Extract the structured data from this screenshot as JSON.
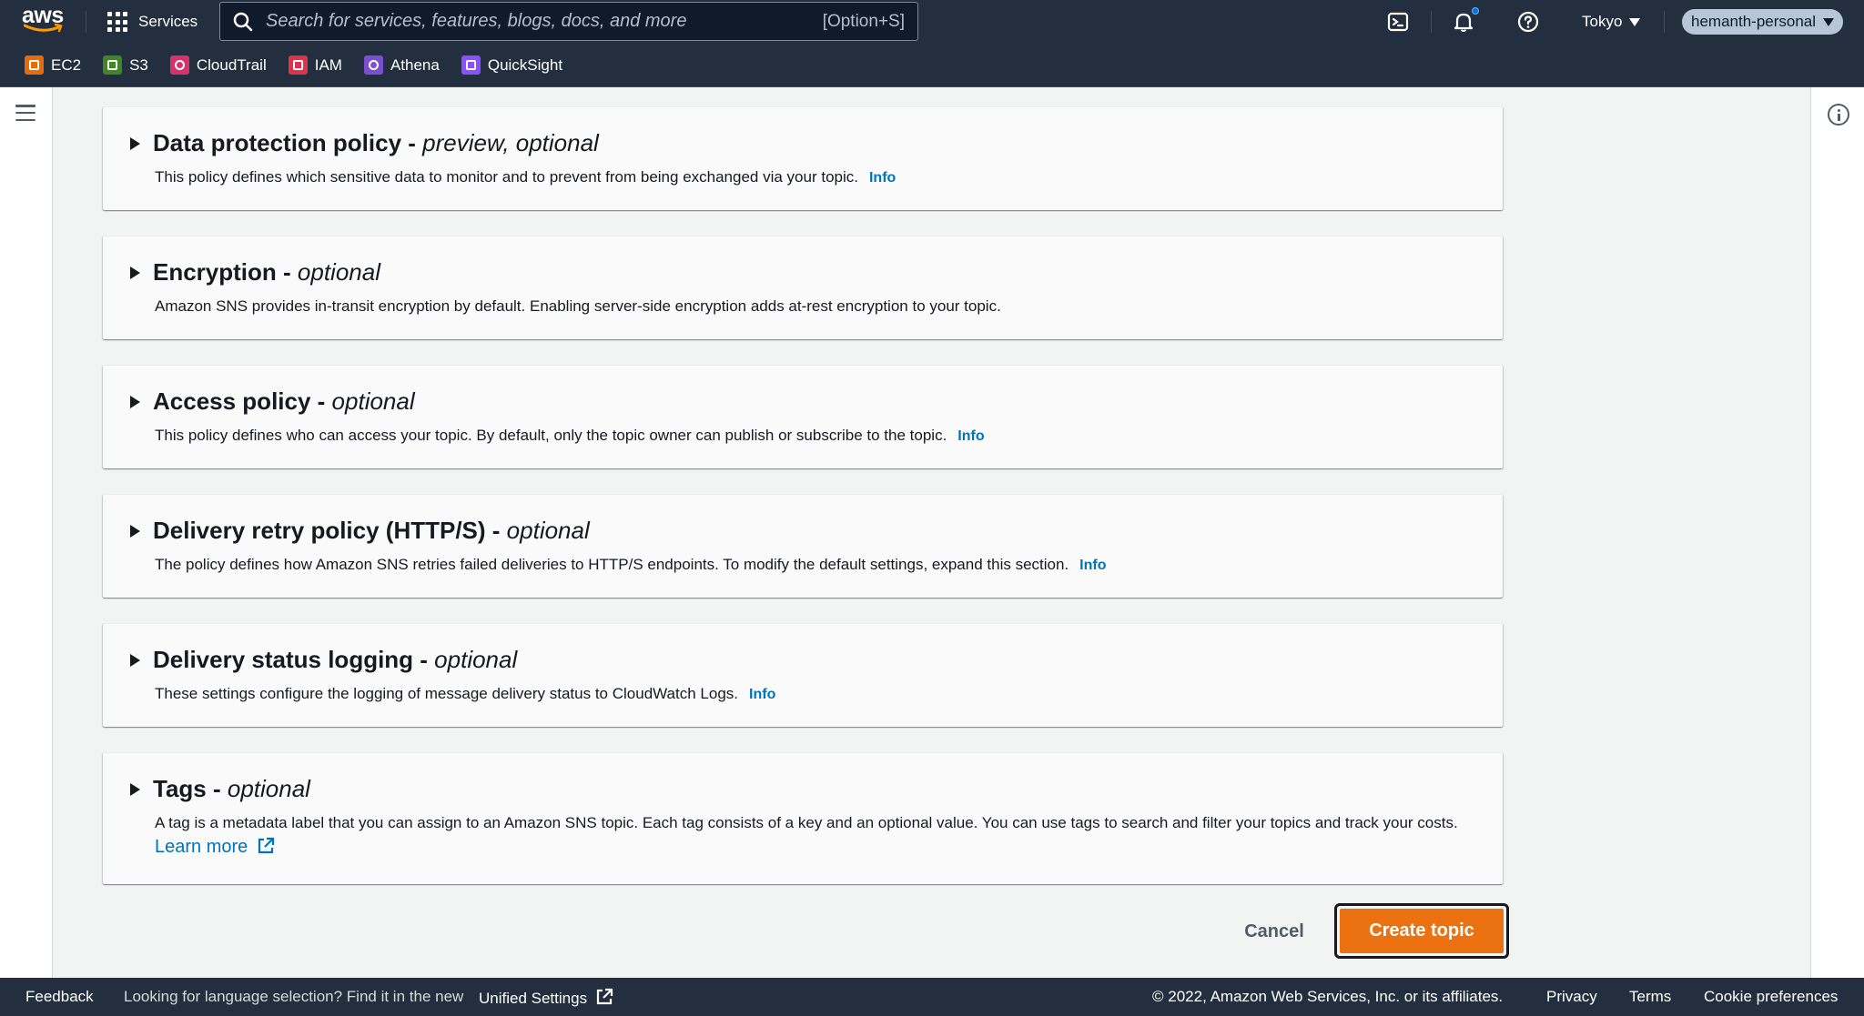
{
  "topnav": {
    "logo_text": "aws",
    "services_label": "Services",
    "search_placeholder": "Search for services, features, blogs, docs, and more",
    "search_shortcut": "[Option+S]",
    "region": "Tokyo",
    "account": "hemanth-personal"
  },
  "favorites": [
    {
      "label": "EC2",
      "color": "#e46c0a"
    },
    {
      "label": "S3",
      "color": "#3f8624"
    },
    {
      "label": "CloudTrail",
      "color": "#d6336c"
    },
    {
      "label": "IAM",
      "color": "#dd344c"
    },
    {
      "label": "Athena",
      "color": "#7d4ecf"
    },
    {
      "label": "QuickSight",
      "color": "#8c4fff"
    }
  ],
  "sections": [
    {
      "title": "Data protection policy - ",
      "optional": "preview, optional",
      "description": "This policy defines which sensitive data to monitor and to prevent from being exchanged via your topic.",
      "info": "Info"
    },
    {
      "title": "Encryption - ",
      "optional": "optional",
      "description": "Amazon SNS provides in-transit encryption by default. Enabling server-side encryption adds at-rest encryption to your topic.",
      "info": ""
    },
    {
      "title": "Access policy - ",
      "optional": "optional",
      "description": "This policy defines who can access your topic. By default, only the topic owner can publish or subscribe to the topic.",
      "info": "Info"
    },
    {
      "title": "Delivery retry policy (HTTP/S) - ",
      "optional": "optional",
      "description": "The policy defines how Amazon SNS retries failed deliveries to HTTP/S endpoints. To modify the default settings, expand this section.",
      "info": "Info"
    },
    {
      "title": "Delivery status logging - ",
      "optional": "optional",
      "description": "These settings configure the logging of message delivery status to CloudWatch Logs.",
      "info": "Info"
    },
    {
      "title": "Tags - ",
      "optional": "optional",
      "description": "A tag is a metadata label that you can assign to an Amazon SNS topic. Each tag consists of a key and an optional value. You can use tags to search and filter your topics and track your costs.",
      "learn_more": "Learn more"
    }
  ],
  "actions": {
    "cancel": "Cancel",
    "create": "Create topic"
  },
  "footer": {
    "feedback": "Feedback",
    "language_prompt": "Looking for language selection? Find it in the new",
    "unified_settings": "Unified Settings",
    "copyright": "© 2022, Amazon Web Services, Inc. or its affiliates.",
    "privacy": "Privacy",
    "terms": "Terms",
    "cookie": "Cookie preferences"
  }
}
